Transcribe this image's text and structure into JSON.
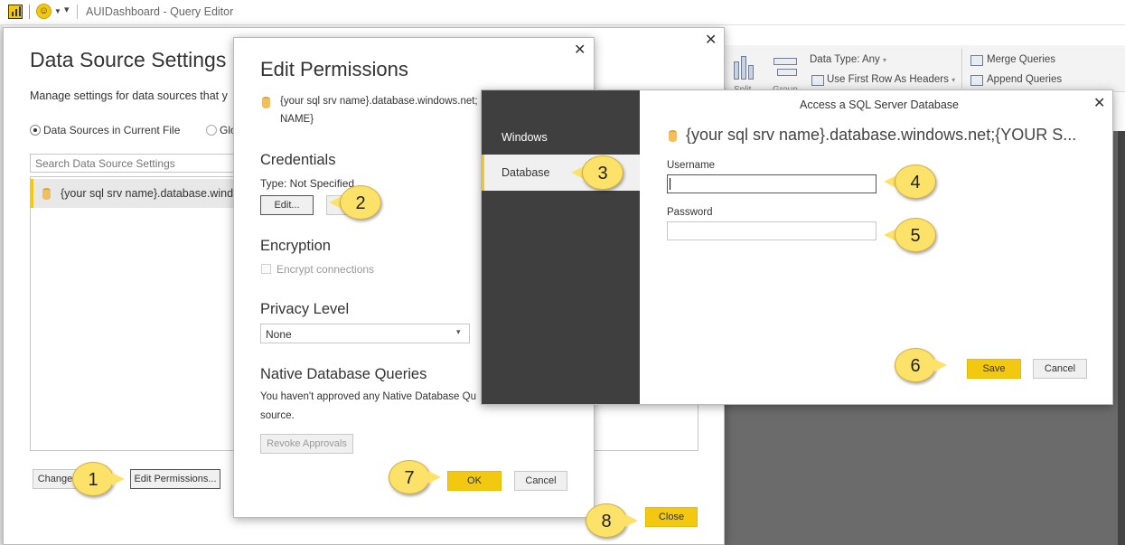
{
  "titlebar": {
    "window_title": "AUIDashboard - Query Editor"
  },
  "ribbon": {
    "data_type": "Data Type: Any",
    "first_row_headers": "Use First Row As Headers",
    "merge_queries": "Merge Queries",
    "append_queries": "Append Queries",
    "split_partial": "Split",
    "group_partial": "Group"
  },
  "data_source_settings": {
    "title": "Data Source Settings",
    "description": "Manage settings for data sources that y",
    "radio_current": "Data Sources in Current File",
    "radio_global": "Glo",
    "search_placeholder": "Search Data Source Settings",
    "source_item": "{your sql srv name}.database.windo",
    "change_button": "Change",
    "edit_permissions_button": "Edit Permissions...",
    "close_button": "Close"
  },
  "edit_permissions": {
    "title": "Edit Permissions",
    "source_line1": "{your sql srv name}.database.windows.net;",
    "source_line2": "NAME}",
    "credentials_heading": "Credentials",
    "credentials_type": "Type: Not Specified",
    "edit_button": "Edit...",
    "encryption_heading": "Encryption",
    "encrypt_label": "Encrypt connections",
    "privacy_heading": "Privacy Level",
    "privacy_value": "None",
    "native_heading": "Native Database Queries",
    "native_text_line1": "You haven't approved any Native Database Qu",
    "native_text_line2": "source.",
    "revoke_button": "Revoke Approvals",
    "ok_button": "OK",
    "cancel_button": "Cancel"
  },
  "sql_access": {
    "title": "Access a SQL Server Database",
    "nav_windows": "Windows",
    "nav_database": "Database",
    "server_text": "{your sql srv name}.database.windows.net;{YOUR S...",
    "username_label": "Username",
    "username_value": "",
    "password_label": "Password",
    "password_value": "",
    "save_button": "Save",
    "cancel_button": "Cancel"
  },
  "callouts": [
    "1",
    "2",
    "3",
    "4",
    "5",
    "6",
    "7",
    "8"
  ]
}
